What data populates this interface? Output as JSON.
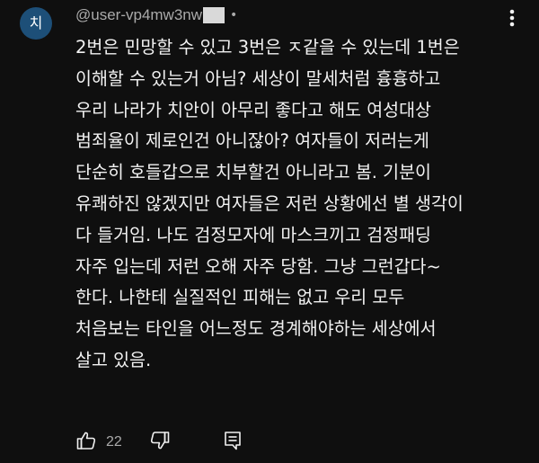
{
  "comment": {
    "avatar_letter": "치",
    "avatar_color": "#1d4f78",
    "username": "@user-vp4mw3nw",
    "separator": "•",
    "lines": [
      "2번은 민망할 수 있고 3번은 ㅈ같을 수 있는데 1번은",
      "이해할 수 있는거 아님? 세상이 말세처럼 흉흉하고",
      "우리 나라가 치안이 아무리 좋다고 해도 여성대상",
      "범죄율이 제로인건 아니잖아? 여자들이 저러는게",
      "단순히 호들갑으로 치부할건 아니라고 봄. 기분이",
      "유쾌하진 않겠지만 여자들은 저런 상황에선 별 생각이",
      "다 들거임. 나도 검정모자에 마스크끼고 검정패딩",
      "자주 입는데 저런 오해 자주 당함. 그냥 그런갑다~",
      "한다. 나한테 실질적인 피해는 없고 우리 모두",
      "처음보는 타인을 어느정도 경계해야하는 세상에서",
      "살고 있음."
    ],
    "like_count": "22",
    "icons": {
      "more": "more-vertical-icon",
      "like": "thumbs-up-icon",
      "dislike": "thumbs-down-icon",
      "reply": "reply-comment-icon"
    }
  }
}
